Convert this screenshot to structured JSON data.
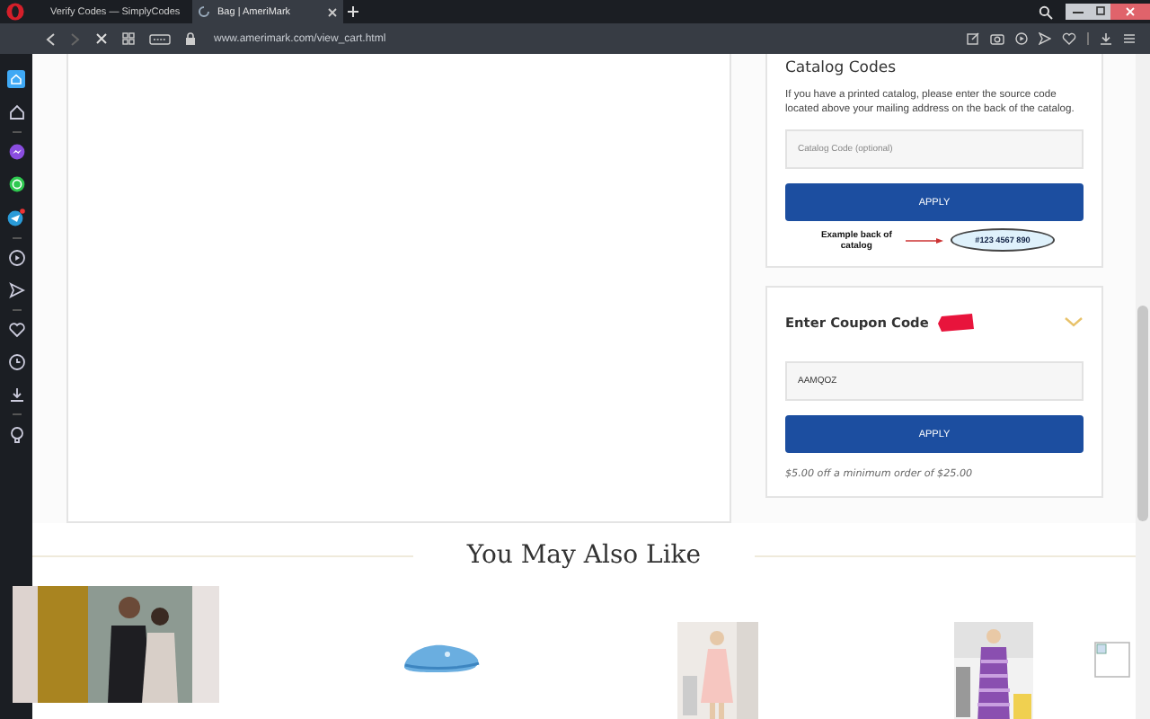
{
  "browser": {
    "tabs": [
      {
        "title": "Verify Codes — SimplyCodes",
        "selected": false
      },
      {
        "title": "Bag | AmeriMark",
        "selected": true
      }
    ],
    "address": "www.amerimark.com/view_cart.html"
  },
  "catalog": {
    "title": "Catalog Codes",
    "description": "If you have a printed catalog, please enter the source code located above your mailing address on the back of the catalog.",
    "placeholder": "Catalog Code (optional)",
    "button": "APPLY",
    "example_label": "Example back of catalog",
    "example_code": "#123 4567 890"
  },
  "coupon": {
    "title": "Enter Coupon Code",
    "value": "AAMQOZ",
    "button": "APPLY",
    "note": "$5.00 off a minimum order of $25.00"
  },
  "recommendations": {
    "title": "You May Also Like"
  }
}
